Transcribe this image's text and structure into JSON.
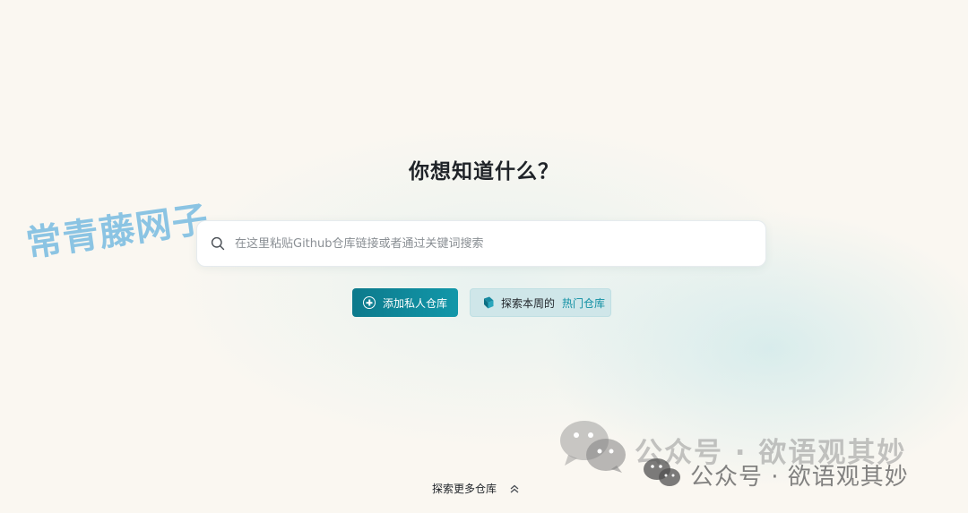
{
  "hero": {
    "title": "你想知道什么？"
  },
  "search": {
    "placeholder": "在这里粘贴Github仓库链接或者通过关键词搜索",
    "icon": "search-icon"
  },
  "actions": {
    "add_private_label": "添加私人仓库",
    "explore_label": "探索本周的",
    "hot_label": "热门仓库"
  },
  "footer": {
    "explore_more_label": "探索更多仓库"
  },
  "watermarks": {
    "logo_text": "常青藤网子",
    "wechat_line1": "公众号 · 欲语观其妙",
    "wechat_line2": "公众号 · 欲语观其妙"
  },
  "colors": {
    "accent": "#0f8fa3",
    "primary_button": "#0d7a8c",
    "secondary_button": "#cfe6e9",
    "background": "#faf7f1"
  }
}
